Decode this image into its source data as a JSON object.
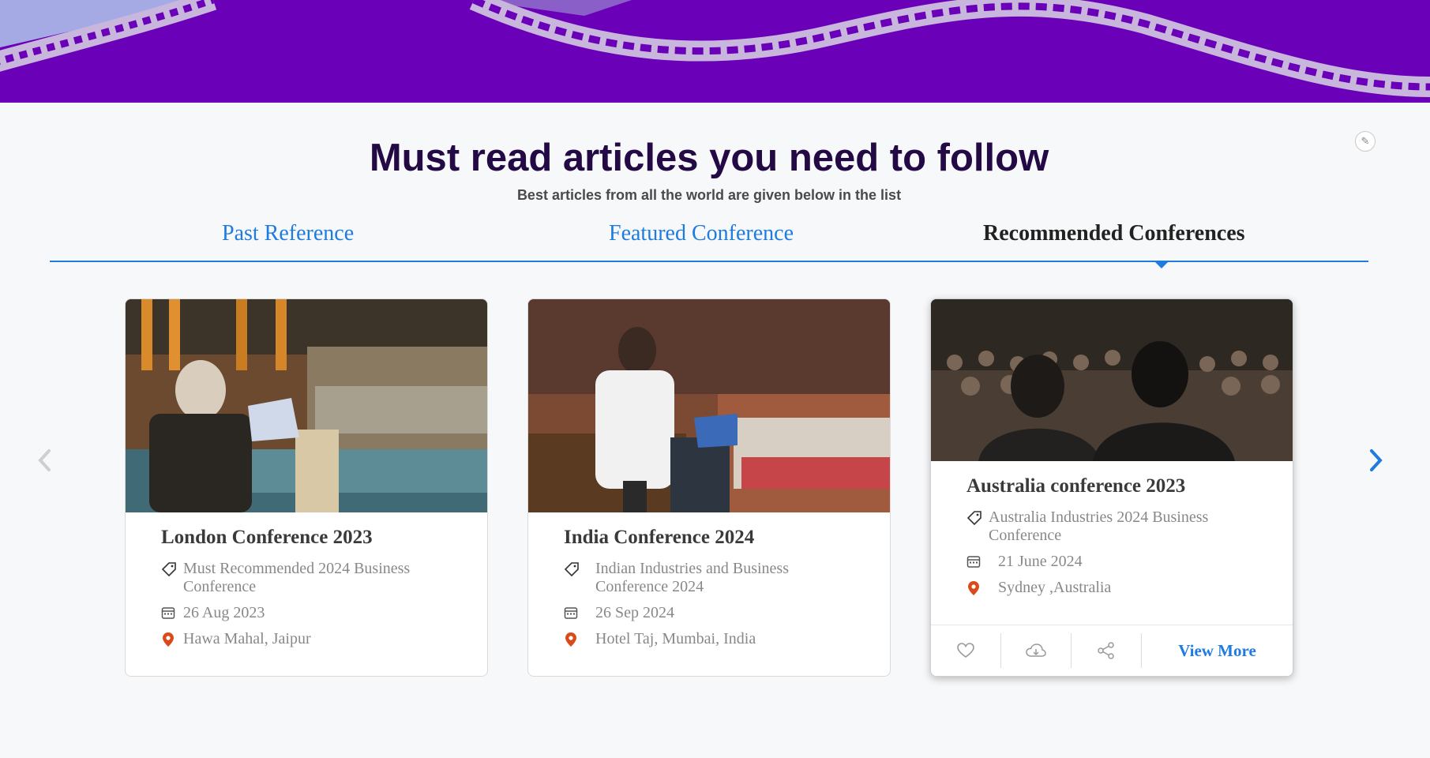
{
  "header": {
    "title": "Must read articles you need to follow",
    "subtitle": "Best articles from all the world are given below in the list"
  },
  "tabs": [
    {
      "label": "Past Reference",
      "active": false
    },
    {
      "label": "Featured Conference",
      "active": false
    },
    {
      "label": "Recommended Conferences",
      "active": true
    }
  ],
  "cards": [
    {
      "title": "London Conference 2023",
      "category": "Must Recommended 2024 Business Conference",
      "date": "26 Aug 2023",
      "location": "Hawa Mahal, Jaipur",
      "image": "conference-speaker-photo"
    },
    {
      "title": "India Conference 2024",
      "category": "Indian Industries and Business Conference 2024",
      "date": "26 Sep 2024",
      "location": "Hotel Taj, Mumbai, India",
      "image": "conference-speaker-photo"
    },
    {
      "title": "Australia conference 2023",
      "category": "Australia Industries 2024 Business Conference",
      "date": "21 June 2024",
      "location": "Sydney ,Australia",
      "image": "audience-photo",
      "actions": {
        "view_more": "View More"
      }
    }
  ],
  "colors": {
    "banner": "#6a00b8",
    "accent": "#1e7be0",
    "title": "#230a45",
    "pin": "#d94b1a"
  },
  "icons": [
    "edit-icon",
    "tag-icon",
    "calendar-icon",
    "location-pin-icon",
    "heart-icon",
    "cloud-icon",
    "share-icon",
    "chevron-left-icon",
    "chevron-right-icon"
  ]
}
